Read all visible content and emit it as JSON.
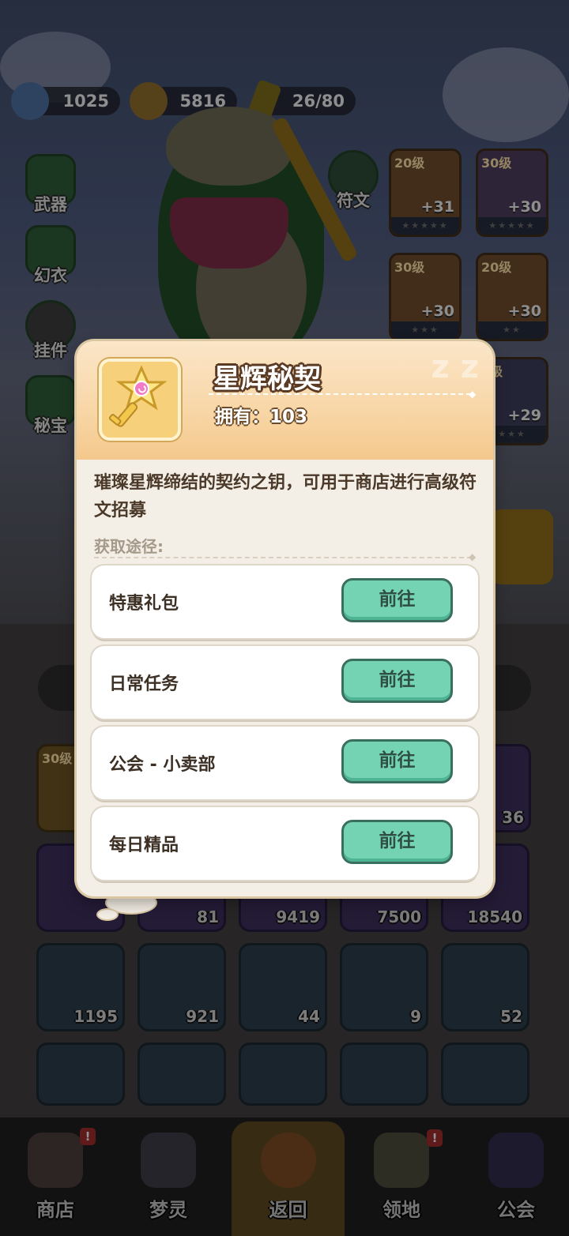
{
  "resources": {
    "gems": "1025",
    "coins": "5816",
    "energy": "26/80"
  },
  "side_menu": [
    "武器",
    "幻衣",
    "挂件",
    "秘宝"
  ],
  "rune_label": "符文",
  "equipment": [
    {
      "level": "20级",
      "bonus": "+31"
    },
    {
      "level": "30级",
      "bonus": "+30"
    },
    {
      "level": "30级",
      "bonus": "+30"
    },
    {
      "level": "20级",
      "bonus": "+30"
    },
    {
      "level": "0级",
      "bonus": "+29"
    }
  ],
  "inventory_row1": {
    "left_level": "30级",
    "right_count": "36"
  },
  "inventory_row2": [
    "",
    "81",
    "9419",
    "7500",
    "18540"
  ],
  "inventory_row3": [
    "1195",
    "921",
    "44",
    "9",
    "52"
  ],
  "dialog": {
    "title": "星辉秘契",
    "owned_label": "拥有：",
    "owned_count": "103",
    "description": "璀璨星辉缔结的契约之钥，可用于商店进行高级符文招募",
    "source_label": "获取途径:",
    "sources": [
      {
        "name": "特惠礼包",
        "button": "前往"
      },
      {
        "name": "日常任务",
        "button": "前往"
      },
      {
        "name": "公会 - 小卖部",
        "button": "前往"
      },
      {
        "name": "每日精品",
        "button": "前往"
      }
    ]
  },
  "bottom_nav": [
    {
      "label": "商店",
      "badge": "!"
    },
    {
      "label": "梦灵",
      "badge": ""
    },
    {
      "label": "返回",
      "badge": ""
    },
    {
      "label": "领地",
      "badge": "!"
    },
    {
      "label": "公会",
      "badge": ""
    }
  ],
  "colors": {
    "go_button": "#74d3b3",
    "dialog_bg": "#f4efe6",
    "header_gradient_end": "#f4c88c"
  }
}
